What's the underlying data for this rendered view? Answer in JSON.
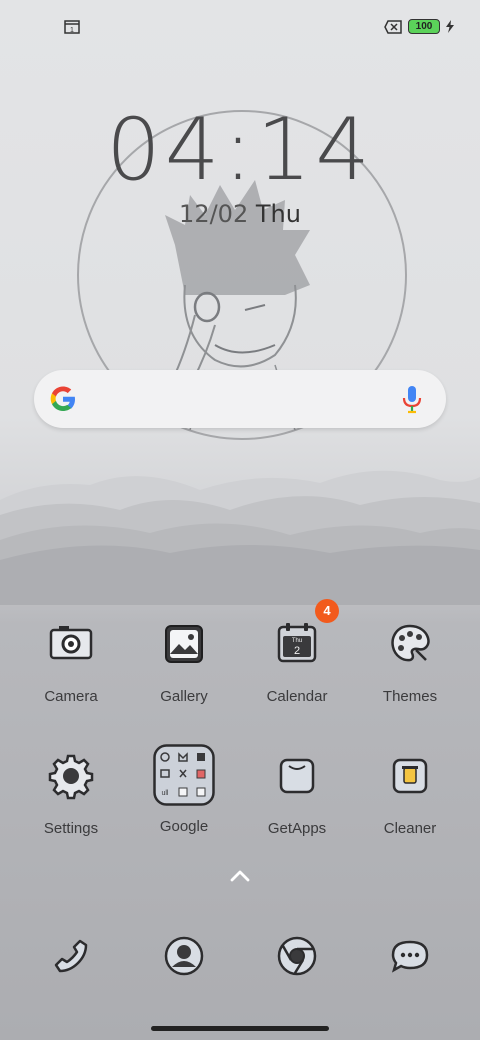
{
  "status_bar": {
    "left_icon": "sim-card-icon",
    "no-sim-icon": "no-sim-icon",
    "battery_level": "100",
    "charging_icon": "lightning-icon"
  },
  "lockclock": {
    "time": "04:14",
    "date": "12/02",
    "day": "Thu"
  },
  "search": {
    "logo": "google-g-icon",
    "mic": "microphone-icon"
  },
  "apps_row1": [
    {
      "label": "Camera",
      "icon": "camera-icon"
    },
    {
      "label": "Gallery",
      "icon": "gallery-icon"
    },
    {
      "label": "Calendar",
      "icon": "calendar-icon",
      "badge": "4",
      "icon_day": "Thu",
      "icon_date": "2"
    },
    {
      "label": "Themes",
      "icon": "palette-icon"
    }
  ],
  "apps_row2": [
    {
      "label": "Settings",
      "icon": "gear-icon"
    },
    {
      "label": "Google",
      "icon": "google-folder-icon"
    },
    {
      "label": "GetApps",
      "icon": "bag-icon"
    },
    {
      "label": "Cleaner",
      "icon": "trash-icon"
    }
  ],
  "dock": [
    {
      "name": "phone",
      "icon": "phone-icon"
    },
    {
      "name": "contacts",
      "icon": "contact-icon"
    },
    {
      "name": "chrome",
      "icon": "chrome-icon"
    },
    {
      "name": "messages",
      "icon": "message-icon"
    }
  ],
  "colors": {
    "badge": "#f25a1c",
    "battery": "#5bd25a"
  }
}
